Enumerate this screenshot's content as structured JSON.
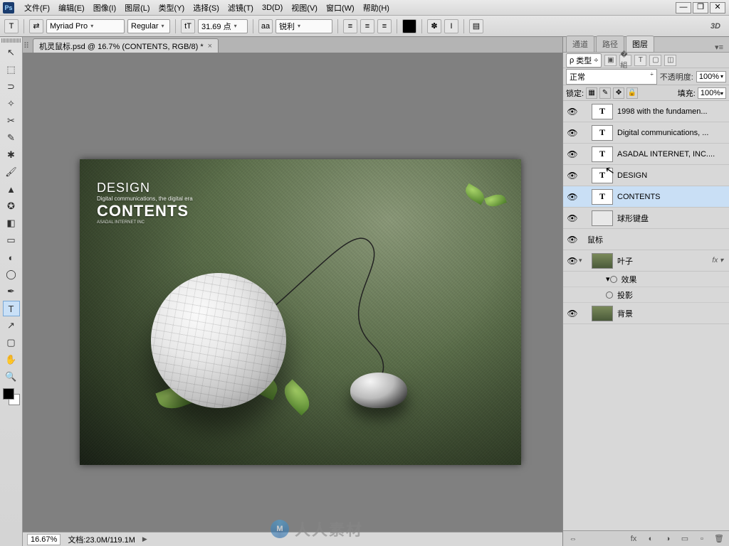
{
  "app": {
    "psIcon": "Ps"
  },
  "menu": {
    "file": "文件(F)",
    "edit": "编辑(E)",
    "image": "图像(I)",
    "layer": "图层(L)",
    "type": "类型(Y)",
    "select": "选择(S)",
    "filter": "滤镜(T)",
    "threeD": "3D(D)",
    "view": "视图(V)",
    "window": "窗口(W)",
    "help": "帮助(H)"
  },
  "winbtns": {
    "min": "—",
    "max": "❐",
    "close": "✕"
  },
  "options": {
    "toolGlyph": "T",
    "toggleGlyph": "⇄",
    "font": "Myriad Pro",
    "style": "Regular",
    "sizeIcon": "tT",
    "size": "31.69 点",
    "aaIcon": "aa",
    "aa": "锐利",
    "alignL": "≡",
    "alignC": "≡",
    "alignR": "≡",
    "warpedIcon": "✽",
    "warpIcon": "I",
    "paraIcon": "▤",
    "threeD": "3D"
  },
  "docTab": {
    "title": "机灵鼠标.psd @ 16.7% (CONTENTS, RGB/8) *",
    "close": "×"
  },
  "tools": {
    "move": "↖",
    "marquee": "⬚",
    "lasso": "⊃",
    "wand": "✧",
    "crop": "✂",
    "eyedrop": "✎",
    "heal": "✱",
    "brush": "🖌",
    "stamp": "▲",
    "history": "✪",
    "eraser": "◧",
    "grad": "▭",
    "blur": "◐",
    "dodge": "◯",
    "pen": "✒",
    "type": "T",
    "path": "↗",
    "rect": "▢",
    "hand": "✋",
    "zoom": "🔍"
  },
  "status": {
    "zoom": "16.67%",
    "doc": "文档:23.0M/119.1M",
    "arrow": "▶"
  },
  "panels": {
    "tabs": {
      "channels": "通道",
      "paths": "路径",
      "layers": "图层",
      "menu": "▾≡"
    },
    "filter": {
      "searchIcon": "ρ",
      "kind": "类型",
      "arr": "÷",
      "i1": "▣",
      "i2": "�組",
      "i3": "T",
      "i4": "▢",
      "i5": "◫"
    },
    "blend": {
      "mode": "正常",
      "opacityLbl": "不透明度:",
      "opacity": "100%"
    },
    "lock": {
      "lbl": "锁定:",
      "i1": "▦",
      "i2": "✎",
      "i3": "✥",
      "i4": "🔒",
      "fillLbl": "填充:",
      "fill": "100%"
    },
    "layers": [
      {
        "vis": "👁",
        "thumb": "T",
        "thumbClass": "T",
        "name": "1998 with the fundamen..."
      },
      {
        "vis": "👁",
        "thumb": "T",
        "thumbClass": "T",
        "name": "Digital communications, ..."
      },
      {
        "vis": "👁",
        "thumb": "T",
        "thumbClass": "T",
        "name": "ASADAL INTERNET, INC...."
      },
      {
        "vis": "👁",
        "thumb": "T",
        "thumbClass": "T",
        "name": "DESIGN"
      },
      {
        "vis": "👁",
        "thumb": "T",
        "thumbClass": "T",
        "name": "CONTENTS",
        "sel": true
      },
      {
        "vis": "👁",
        "thumb": "",
        "thumbClass": "ball",
        "name": "球形键盘"
      },
      {
        "vis": "👁",
        "thumb": "",
        "thumbClass": "mouse",
        "name": "鼠标"
      },
      {
        "vis": "👁",
        "thumb": "",
        "thumbClass": "img",
        "name": "叶子",
        "fx": "fx",
        "expanded": true,
        "sub": [
          {
            "name": "效果",
            "tw": "▾"
          },
          {
            "name": "投影",
            "tw": ""
          }
        ]
      },
      {
        "vis": "👁",
        "thumb": "",
        "thumbClass": "img",
        "name": "背景"
      }
    ],
    "footer": {
      "link": "⇔",
      "fx": "fx",
      "mask": "◐",
      "adj": "◑",
      "group": "▭",
      "new": "▫",
      "trash": "🗑"
    }
  },
  "artwork": {
    "design": "DESIGN",
    "sub": "Digital communications, the digital era",
    "contents": "CONTENTS",
    "tiny": "ASADAL INTERNET INC"
  },
  "watermark": {
    "logo": "M",
    "text": "人人素材"
  }
}
